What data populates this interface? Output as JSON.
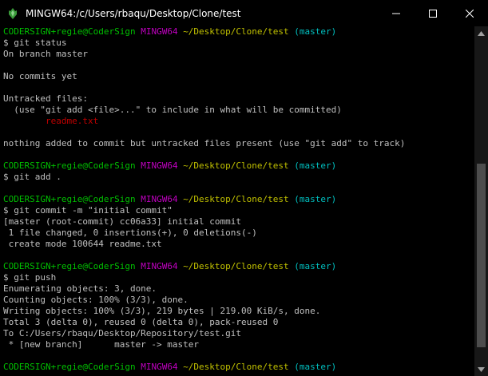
{
  "window": {
    "title": "MINGW64:/c/Users/rbaqu/Desktop/Clone/test",
    "app_icon": "mingw-icon",
    "controls": {
      "minimize_icon": "minimize-icon",
      "maximize_icon": "maximize-icon",
      "close_icon": "close-icon"
    }
  },
  "colors": {
    "background": "#000000",
    "text": "#c0c0c0",
    "prompt_user": "#00c000",
    "prompt_system": "#c000c0",
    "prompt_path": "#c0c000",
    "prompt_branch": "#00c0c0",
    "untracked_file": "#c00000"
  },
  "terminal": {
    "prompts": [
      {
        "user": "CODERSIGN+regie@CoderSign",
        "system": "MINGW64",
        "path": "~/Desktop/Clone/test",
        "branch": "(master)"
      },
      {
        "user": "CODERSIGN+regie@CoderSign",
        "system": "MINGW64",
        "path": "~/Desktop/Clone/test",
        "branch": "(master)"
      },
      {
        "user": "CODERSIGN+regie@CoderSign",
        "system": "MINGW64",
        "path": "~/Desktop/Clone/test",
        "branch": "(master)"
      },
      {
        "user": "CODERSIGN+regie@CoderSign",
        "system": "MINGW64",
        "path": "~/Desktop/Clone/test",
        "branch": "(master)"
      },
      {
        "user": "CODERSIGN+regie@CoderSign",
        "system": "MINGW64",
        "path": "~/Desktop/Clone/test",
        "branch": "(master)"
      }
    ],
    "commands": [
      "$ git status",
      "$ git add .",
      "$ git commit -m \"initial commit\"",
      "$ git push"
    ],
    "status_output": {
      "branch": "On branch master",
      "no_commits": "No commits yet",
      "untracked_header": "Untracked files:",
      "untracked_hint": "  (use \"git add <file>...\" to include in what will be committed)",
      "untracked_file": "        readme.txt",
      "summary": "nothing added to commit but untracked files present (use \"git add\" to track)"
    },
    "commit_output": [
      "[master (root-commit) cc06a33] initial commit",
      " 1 file changed, 0 insertions(+), 0 deletions(-)",
      " create mode 100644 readme.txt"
    ],
    "push_output": [
      "Enumerating objects: 3, done.",
      "Counting objects: 100% (3/3), done.",
      "Writing objects: 100% (3/3), 219 bytes | 219.00 KiB/s, done.",
      "Total 3 (delta 0), reused 0 (delta 0), pack-reused 0",
      "To C:/Users/rbaqu/Desktop/Repository/test.git",
      " * [new branch]      master -> master"
    ]
  },
  "scrollbar": {
    "up_icon": "scroll-up-arrow-icon",
    "down_icon": "scroll-down-arrow-icon"
  }
}
